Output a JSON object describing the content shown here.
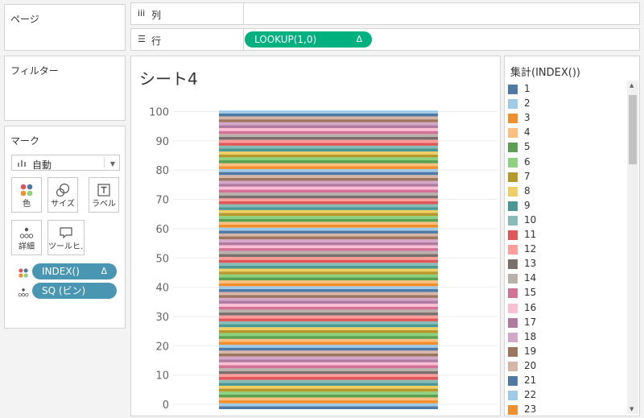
{
  "pages": {
    "title": "ページ"
  },
  "filters": {
    "title": "フィルター"
  },
  "marks": {
    "title": "マーク",
    "mark_type": "自動",
    "buttons": [
      {
        "label": "色",
        "icon": "color-icon"
      },
      {
        "label": "サイズ",
        "icon": "size-icon"
      },
      {
        "label": "ラベル",
        "icon": "label-icon"
      },
      {
        "label": "詳細",
        "icon": "detail-icon"
      },
      {
        "label": "ツールヒ…",
        "icon": "tooltip-icon"
      }
    ],
    "fields": [
      {
        "name": "INDEX()",
        "delta": "Δ",
        "icon": "color-icon"
      },
      {
        "name": "SQ (ビン)",
        "icon": "detail-icon"
      }
    ]
  },
  "columns_shelf": {
    "icon": "iii",
    "label": "列"
  },
  "rows_shelf": {
    "icon": "☰",
    "label": "行",
    "pill": "LOOKUP(1,0)",
    "pill_delta": "Δ"
  },
  "sheet": {
    "title": "シート4"
  },
  "chart_data": {
    "type": "bar",
    "stacked": true,
    "ylim": [
      0,
      102
    ],
    "yticks": [
      0,
      10,
      20,
      30,
      40,
      50,
      60,
      70,
      80,
      90,
      100
    ],
    "segments": 102,
    "segment_value": 1,
    "grid": true,
    "xlabel": "",
    "ylabel": ""
  },
  "legend": {
    "title": "集計(INDEX())",
    "items": [
      {
        "label": "1",
        "color": "#4e79a7"
      },
      {
        "label": "2",
        "color": "#a0cbe8"
      },
      {
        "label": "3",
        "color": "#f28e2b"
      },
      {
        "label": "4",
        "color": "#ffbe7d"
      },
      {
        "label": "5",
        "color": "#59a14f"
      },
      {
        "label": "6",
        "color": "#8cd17d"
      },
      {
        "label": "7",
        "color": "#b6992d"
      },
      {
        "label": "8",
        "color": "#f1ce63"
      },
      {
        "label": "9",
        "color": "#499894"
      },
      {
        "label": "10",
        "color": "#86bcb6"
      },
      {
        "label": "11",
        "color": "#e15759"
      },
      {
        "label": "12",
        "color": "#ff9d9a"
      },
      {
        "label": "13",
        "color": "#79706e"
      },
      {
        "label": "14",
        "color": "#bab0ac"
      },
      {
        "label": "15",
        "color": "#d37295"
      },
      {
        "label": "16",
        "color": "#fabfd2"
      },
      {
        "label": "17",
        "color": "#b07aa1"
      },
      {
        "label": "18",
        "color": "#d4a6c8"
      },
      {
        "label": "19",
        "color": "#9d7660"
      },
      {
        "label": "20",
        "color": "#d7b5a6"
      },
      {
        "label": "21",
        "color": "#4e79a7"
      },
      {
        "label": "22",
        "color": "#a0cbe8"
      },
      {
        "label": "23",
        "color": "#f28e2b"
      }
    ]
  }
}
